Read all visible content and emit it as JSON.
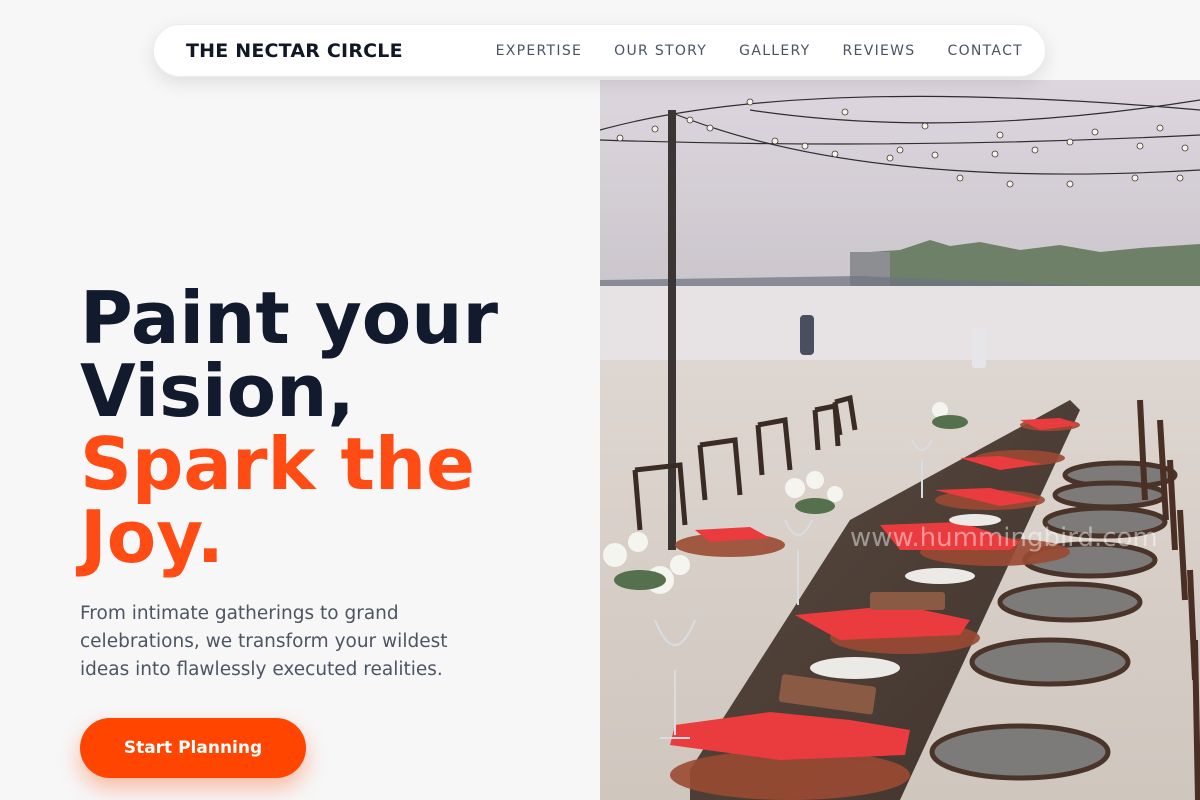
{
  "nav": {
    "brand": "THE NECTAR CIRCLE",
    "links": [
      "EXPERTISE",
      "OUR STORY",
      "GALLERY",
      "REVIEWS",
      "CONTACT"
    ]
  },
  "hero": {
    "title_line1": "Paint your",
    "title_line2": "Vision,",
    "title_accent_line1": "Spark the",
    "title_accent_line2": "Joy.",
    "subtitle": "From intimate gatherings to grand celebrations, we transform your wildest ideas into flawlessly executed realities.",
    "cta_label": "Start Planning"
  },
  "image": {
    "watermark": "www.hummingbird.com"
  },
  "colors": {
    "accent": "#ff4500",
    "heading": "#121a2e",
    "body_text": "#4b5563",
    "background": "#f7f7f7"
  }
}
